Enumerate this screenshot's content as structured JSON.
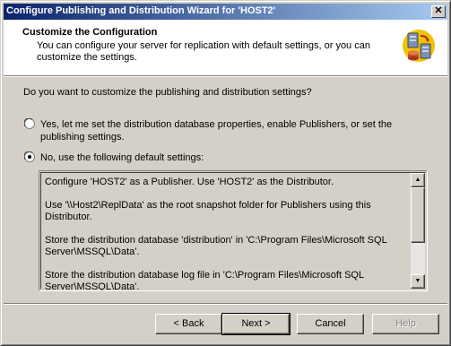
{
  "window": {
    "title": "Configure Publishing and Distribution Wizard for 'HOST2'"
  },
  "header": {
    "title": "Customize the Configuration",
    "description": "You can configure your server for replication with default settings, or you can customize the settings.",
    "icon": "server-replication-icon"
  },
  "question": "Do you want to customize the publishing and distribution settings?",
  "options": [
    {
      "label": "Yes, let me set the distribution database properties, enable Publishers, or set the publishing settings.",
      "selected": false
    },
    {
      "label": "No, use the following default settings:",
      "selected": true
    }
  ],
  "defaults_text": [
    "Configure 'HOST2' as a Publisher. Use 'HOST2' as the Distributor.",
    "Use '\\\\Host2\\ReplData' as the root snapshot folder for Publishers using this Distributor.",
    "Store the distribution database 'distribution' in 'C:\\Program Files\\Microsoft SQL Server\\MSSQL\\Data'.",
    "Store the distribution database log file in 'C:\\Program Files\\Microsoft SQL Server\\MSSQL\\Data'."
  ],
  "buttons": {
    "back": "< Back",
    "next": "Next >",
    "cancel": "Cancel",
    "help": "Help"
  },
  "colors": {
    "titlebar_start": "#0a246a",
    "titlebar_end": "#a6caf0",
    "face": "#d4d0c8"
  }
}
